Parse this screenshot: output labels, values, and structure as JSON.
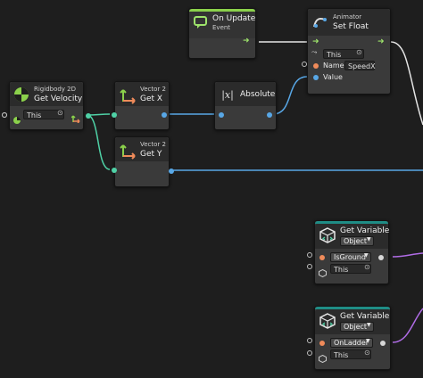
{
  "nodes": {
    "on_update": {
      "title": "On Update",
      "subtitle": "Event"
    },
    "set_float": {
      "category": "Animator",
      "title": "Set Float",
      "target": "This",
      "name_label": "Name",
      "name_value": "SpeedX",
      "value_label": "Value"
    },
    "get_velocity": {
      "category": "Rigidbody 2D",
      "title": "Get Velocity",
      "target": "This"
    },
    "get_x": {
      "category": "Vector 2",
      "title": "Get X"
    },
    "absolute": {
      "icon_text": "|x|",
      "title": "Absolute"
    },
    "get_y": {
      "category": "Vector 2",
      "title": "Get Y"
    },
    "get_var_1": {
      "title": "Get Variable",
      "kind": "Object",
      "variable": "IsGround",
      "target": "This"
    },
    "get_var_2": {
      "title": "Get Variable",
      "kind": "Object",
      "variable": "OnLadder",
      "target": "This"
    }
  },
  "colors": {
    "background": "#1e1e1e",
    "node_body": "#3a3a3a",
    "event_accent": "#8bd14b",
    "variable_accent": "#1f8d86",
    "wire_blue": "#58a7e6",
    "wire_teal": "#4fd1a6",
    "wire_purple": "#b06ce6",
    "wire_flow": "#e6e6e6"
  },
  "icons": {
    "on_update": "event-loop-icon",
    "set_float": "animator-icon",
    "get_velocity": "rigidbody-icon",
    "vector2": "axis-arrows-icon",
    "absolute": "abs-icon",
    "get_variable": "variable-cube-icon"
  }
}
